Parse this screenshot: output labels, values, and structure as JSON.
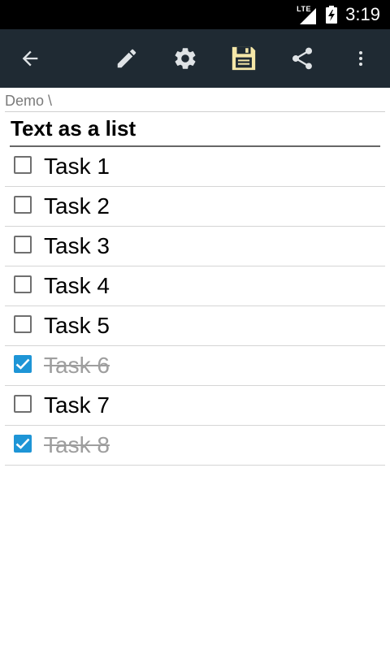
{
  "status_bar": {
    "network": "LTE",
    "time": "3:19"
  },
  "toolbar": {
    "back_icon": "arrow-left-icon",
    "edit_icon": "pencil-icon",
    "settings_icon": "gear-icon",
    "save_icon": "floppy-disk-icon",
    "share_icon": "share-icon",
    "overflow_icon": "more-vertical-icon",
    "save_color": "#f5e7a8",
    "bg_color": "#1f2a33"
  },
  "breadcrumb": "Demo \\",
  "document": {
    "title": "Text as a list"
  },
  "tasks": [
    {
      "label": "Task 1",
      "done": false
    },
    {
      "label": "Task 2",
      "done": false
    },
    {
      "label": "Task 3",
      "done": false
    },
    {
      "label": "Task 4",
      "done": false
    },
    {
      "label": "Task 5",
      "done": false
    },
    {
      "label": "Task 6",
      "done": true
    },
    {
      "label": "Task 7",
      "done": false
    },
    {
      "label": "Task 8",
      "done": true
    }
  ],
  "colors": {
    "checkbox_checked": "#1e95d6",
    "done_text": "#9e9e9e"
  }
}
